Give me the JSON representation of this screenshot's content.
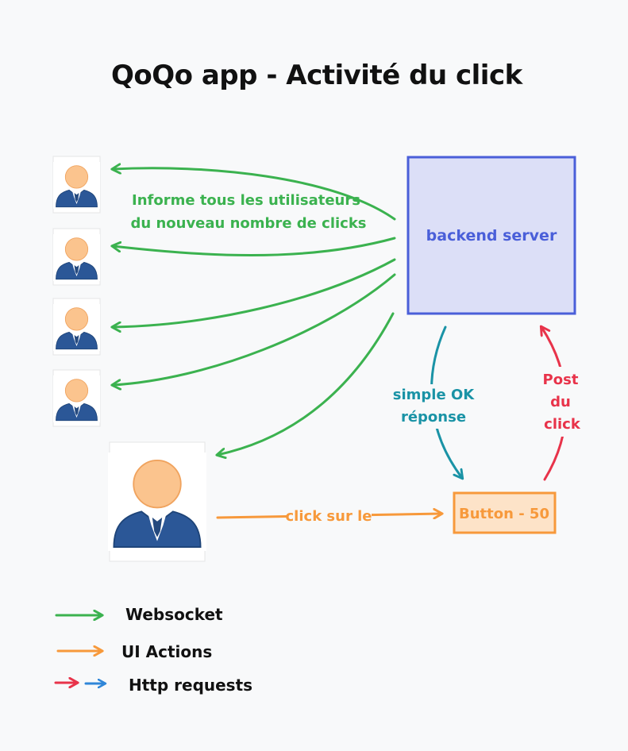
{
  "title": "QoQo app - Activité du click",
  "server": {
    "label": "backend server"
  },
  "button": {
    "label": "Button - 50"
  },
  "labels": {
    "broadcast_line1": "Informe tous les utilisateurs",
    "broadcast_line2": "du nouveau nombre de clicks",
    "response_line1": "simple OK",
    "response_line2": "réponse",
    "post_line1": "Post",
    "post_line2": "du",
    "post_line3": "click",
    "click_action": "click sur le"
  },
  "legend": [
    {
      "label": "Websocket",
      "colors": [
        "#3bb24f"
      ]
    },
    {
      "label": "UI Actions",
      "colors": [
        "#f7993b"
      ]
    },
    {
      "label": "Http requests",
      "colors": [
        "#e8334a",
        "#2f86d8"
      ]
    }
  ],
  "colors": {
    "websocket": "#3bb24f",
    "ui_action": "#f7993b",
    "http_request": "#e8334a",
    "http_response": "#1a93a6",
    "server_fill": "#dcdff7",
    "server_stroke": "#4a5fd9",
    "button_fill": "#fde3c8",
    "button_stroke": "#f7993b",
    "user_body": "#2b5797",
    "user_head": "#fbc48e"
  },
  "icons": [
    "user-icon"
  ]
}
